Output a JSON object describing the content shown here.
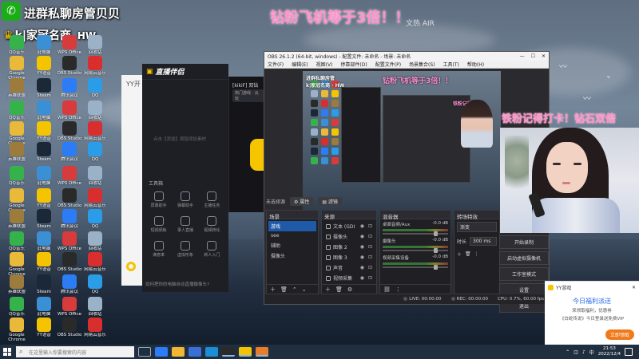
{
  "overlay": {
    "line1": "进群私聊房管贝贝",
    "line2": "k|家冠名商",
    "line2_tag": "HW",
    "top_banner": "钻粉飞机等于3倍！！",
    "right_banner": "铁粉记得打卡！钻石双倍",
    "faint_text": "文热 AIR"
  },
  "desktop_icons": [
    {
      "label": "QQ音乐",
      "color": "#35b34a"
    },
    {
      "label": "此电脑",
      "color": "#3b8fd4"
    },
    {
      "label": "WPS Office",
      "color": "#d83b3b"
    },
    {
      "label": "回收站",
      "color": "#9bb1c8"
    },
    {
      "label": "Google Chrome",
      "color": "#e9b93a"
    },
    {
      "label": "YY语音",
      "color": "#f5c400"
    },
    {
      "label": "OBS Studio",
      "color": "#2a2a2a"
    },
    {
      "label": "网易云音乐",
      "color": "#d92e2e"
    },
    {
      "label": "英雄联盟",
      "color": "#9c7b3c"
    },
    {
      "label": "Steam",
      "color": "#1b2838"
    },
    {
      "label": "腾讯会议",
      "color": "#2c7cf6"
    },
    {
      "label": "QQ",
      "color": "#2b9ce8"
    }
  ],
  "yy_window": {
    "title": "YY开"
  },
  "zbbl": {
    "logo": "直播伴侣",
    "room": "[kikiF] 双钻",
    "tab": "热门游戏 · 云玩",
    "hint": "点击【添加】按钮添加素材",
    "section": "工具箱",
    "tools": [
      "屏幕助手",
      "弹幕助手",
      "主播任务",
      "短视频板",
      "录人直播",
      "视频转化",
      "满意率",
      "虚拟形象",
      "新人入门"
    ],
    "footer": "如何把你的电脑自动直播摄像头?"
  },
  "obs": {
    "title": "OBS 26.1.2 (64-bit, windows) - 配置文件: 未命名 - 场景: 未命名",
    "menu": [
      "文件(F)",
      "编辑(E)",
      "视图(V)",
      "停靠部件(D)",
      "配置文件(P)",
      "场景集合(S)",
      "工具(T)",
      "帮助(H)"
    ],
    "no_source": "未选择源",
    "props_btn": "属性",
    "filters_btn": "滤镜",
    "scenes_title": "场景",
    "scenes": [
      "游戏",
      "see",
      "辅助",
      "摄像头"
    ],
    "sources_title": "来源",
    "sources": [
      "文本 (GDI",
      "摄像头",
      "图像 2",
      "图像 3",
      "声音",
      "视频采集"
    ],
    "mixer_title": "混音器",
    "mixer": [
      {
        "name": "桌面音频/Aux",
        "db": "-0.0 dB",
        "fader": 0.78
      },
      {
        "name": "摄像头",
        "db": "-0.0 dB",
        "fader": 0.78
      },
      {
        "name": "视频采集设备",
        "db": "-0.0 dB",
        "fader": 0.78
      }
    ],
    "transitions_title": "转场特效",
    "transition": "渐变",
    "duration_label": "时长",
    "duration": "300 ms",
    "controls": [
      "开始录制",
      "启动虚拟摄像机",
      "工作室模式",
      "设置",
      "退出"
    ],
    "status": {
      "live": "LIVE: 00:00:00",
      "rec": "REC: 00:00:00",
      "cpu": "CPU: 0.7%, 60.00 fps"
    },
    "preview_text_top": "钻粉飞机等于3倍！！",
    "preview_text_left1": "进群私聊房管",
    "preview_text_left2": "k|家冠名商 · HW",
    "preview_text_right": "铁粉记得打卡！"
  },
  "yy_popup": {
    "app": "YY游戏",
    "title": "今日福利派送",
    "line1": "来领取福利，优惠券",
    "line2": "《白蛇传说》今日登录送免费VIP",
    "cta": "立即领取"
  },
  "taskbar": {
    "search_placeholder": "在这里输入你要搜索的内容",
    "time": "21:53",
    "date": "2022/12/4",
    "ime": "中"
  },
  "colors": {
    "accent_pink": "#ff8fd0",
    "obs_bg": "#2b2b2f",
    "zbbl_yellow": "#f7c500",
    "selection_blue": "#1e5aa8"
  }
}
